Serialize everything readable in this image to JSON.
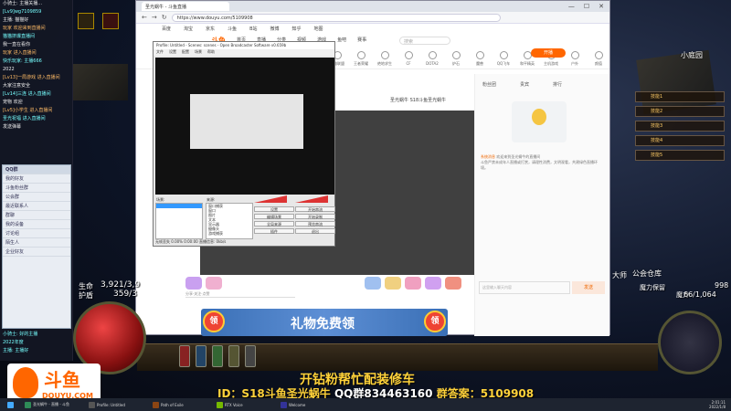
{
  "chat": {
    "lines": [
      {
        "text": "小骑士: 主播关播...",
        "tone": "white"
      },
      {
        "text": "[Lv9]wg7109859",
        "tone": "cyan"
      },
      {
        "text": "主播: 猫猫好",
        "tone": "white"
      },
      {
        "text": "玩家 欢迎来到直播间",
        "tone": "orange"
      },
      {
        "text": "猫猫挤爆直播间",
        "tone": "cyan"
      },
      {
        "text": "我一直在看你",
        "tone": "white"
      },
      {
        "text": "玩家 进入直播间",
        "tone": "orange"
      },
      {
        "text": "快乐玩家: 主播666",
        "tone": "cyan"
      },
      {
        "text": "2022",
        "tone": "white"
      },
      {
        "text": "[Lv13]一局游戏 进入直播间",
        "tone": "orange"
      },
      {
        "text": "大家注意安全",
        "tone": "white"
      },
      {
        "text": "[Lv14]三连 进入直播间",
        "tone": "cyan"
      },
      {
        "text": "宠物 欢迎",
        "tone": "white"
      },
      {
        "text": "[Lv5]小学生 进入直播间",
        "tone": "orange"
      },
      {
        "text": "圣光祝福 进入直播间",
        "tone": "cyan"
      },
      {
        "text": "发送弹幕",
        "tone": "white"
      }
    ],
    "qq": {
      "title": "QQ群",
      "rows": [
        "我的好友",
        "斗鱼粉丝群",
        "公会群",
        "最近联系人",
        "群聊",
        "我的设备",
        "讨论组",
        "陌生人",
        "企业好友"
      ]
    },
    "bottom_lines": [
      "小骑士: 好的主播",
      "2022年度",
      "主播: 主播好"
    ]
  },
  "browser": {
    "tab_label": "圣光蜗牛 - 斗鱼直播",
    "url": "https://www.douyu.com/5109908",
    "bookmarks": [
      "百度",
      "淘宝",
      "京东",
      "斗鱼",
      "B站",
      "微博",
      "知乎",
      "地图"
    ],
    "site_logo": "斗鱼",
    "nav_top": [
      "首页",
      "直播",
      "分类",
      "视频",
      "游戏",
      "鱼吧",
      "赛事"
    ],
    "search_placeholder": "搜索",
    "categories": [
      "英雄联盟",
      "王者荣耀",
      "绝地求生",
      "CF",
      "DOTA2",
      "炉石",
      "魔兽",
      "QQ飞车",
      "和平精英",
      "主机游戏",
      "户外",
      "颜值"
    ],
    "open_live_button": "开播",
    "room_title": "圣光蜗牛 S18斗鱼圣光蜗牛",
    "side_tabs": [
      "粉丝团",
      "贵宾",
      "排行"
    ],
    "notice_label": "系统消息",
    "notice_highlight": "欢迎来到圣光蜗牛的直播间",
    "notice_text": "斗鱼严禁未成年人直播或打赏，请理性消费，文明观看，共建绿色直播环境。",
    "chat_placeholder": "这里输入聊天内容",
    "send_button": "发送",
    "gift_input_placeholder": "分享·关注·点赞"
  },
  "obs": {
    "title": "Profile: Untitled - Scenes: scenes - Open Broadcaster Software v0.659b",
    "menu": [
      "文件",
      "设置",
      "配置",
      "场景",
      "帮助"
    ],
    "scenes_label": "场景:",
    "sources_label": "来源:",
    "sources": [
      "窗口捕获",
      "窗口",
      "图片",
      "文本",
      "显示器",
      "摄像头",
      "游戏捕获"
    ],
    "buttons": [
      "设置",
      "开始串流",
      "编辑场景",
      "开始录制",
      "全局来源",
      "预览串流",
      "插件",
      "退出"
    ],
    "status": "无帧丢失 0.00%    0:00:00    直播信息: 0kb/s"
  },
  "game": {
    "hp_label": "生命",
    "hp_value": "3,921/3,9",
    "es_label": "护盾",
    "es_value": "359/3",
    "mana_label": "魔力",
    "mana_value": "66/1,064",
    "mana_label2": "魔力保留",
    "top_right": "小庭园",
    "hideout": "公会仓库",
    "npc": "大师",
    "right_num": "998",
    "skills": [
      "技能1",
      "技能2",
      "技能3",
      "技能4",
      "技能5"
    ]
  },
  "banner": {
    "coin": "领",
    "text": "礼物免费领"
  },
  "overlay": {
    "line1": "开钻粉帮忙配装修车",
    "line2_a": "ID：S18斗鱼圣光蜗牛 ",
    "line2_b": "QQ群834463160 ",
    "line2_c": "群答案：5109908"
  },
  "brand": {
    "big": "斗鱼",
    "small": "DOUYU.COM"
  },
  "taskbar": {
    "items": [
      {
        "label": "圣光蜗牛 - 直播 - 斗鱼",
        "color": "#2e8b57"
      },
      {
        "label": "Profile: Untitled",
        "color": "#555555"
      },
      {
        "label": "Path of Exile",
        "color": "#8b4513"
      },
      {
        "label": "RTX Voice",
        "color": "#76b900"
      },
      {
        "label": "Welcome",
        "color": "#333399"
      }
    ],
    "time": "2:01:11",
    "date": "2022/1/8"
  }
}
